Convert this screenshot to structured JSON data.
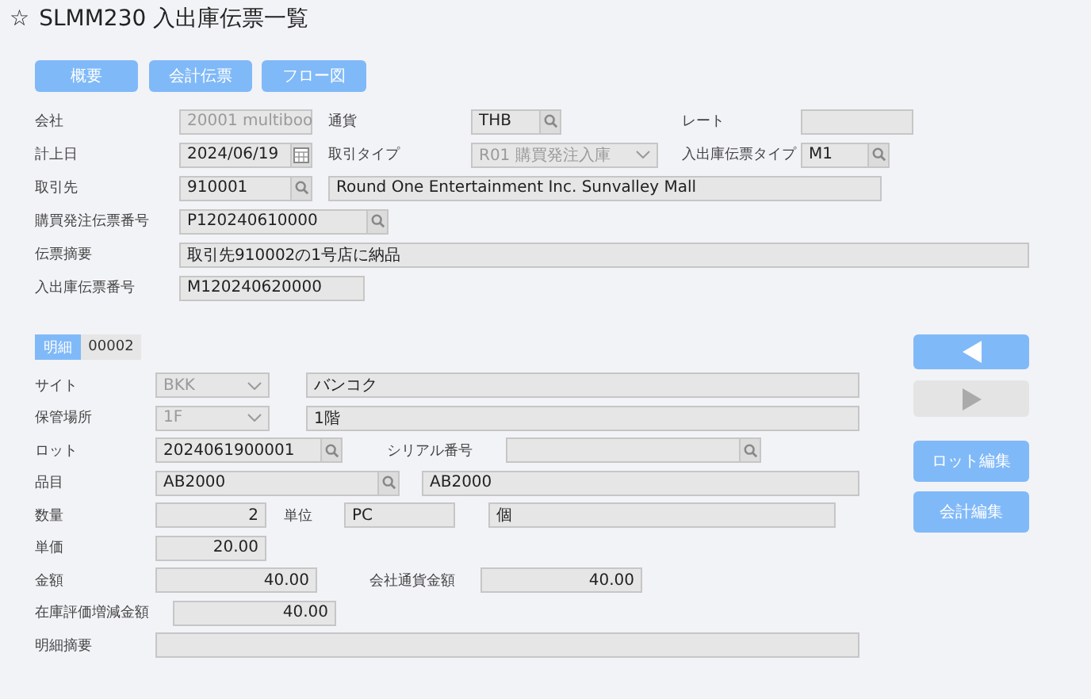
{
  "title": {
    "star": "☆",
    "text": "SLMM230 入出庫伝票一覧"
  },
  "top_buttons": [
    "概要",
    "会計伝票",
    "フロー図"
  ],
  "header_rows": [
    [
      {
        "kind": "label",
        "text": "会社"
      },
      {
        "kind": "select",
        "value": "20001 multiboo",
        "disabled": true
      },
      {
        "kind": "label",
        "text": "通貨"
      },
      {
        "kind": "lookup",
        "value": "THB"
      },
      {
        "kind": "label",
        "text": "レート"
      },
      {
        "kind": "text"
      }
    ],
    [
      {
        "kind": "label",
        "text": "計上日"
      },
      {
        "kind": "date",
        "value": "2024/06/19"
      },
      {
        "kind": "label",
        "text": "取引タイプ"
      },
      {
        "kind": "select",
        "value": "R01 購買発注入庫",
        "disabled": true
      },
      {
        "kind": "label",
        "text": "入出庫伝票タイプ"
      },
      {
        "kind": "lookup",
        "value": "M1"
      }
    ],
    [
      {
        "kind": "label",
        "text": "取引先"
      },
      {
        "kind": "lookup",
        "value": "910001"
      },
      {
        "kind": "text",
        "value": "Round One Entertainment Inc. Sunvalley Mall"
      }
    ],
    [
      {
        "kind": "label",
        "text": "購買発注伝票番号"
      },
      {
        "kind": "lookup",
        "value": "P120240610000"
      }
    ],
    [
      {
        "kind": "label",
        "text": "伝票摘要"
      },
      {
        "kind": "text",
        "value": "取引先910002の1号店に納品"
      }
    ],
    [
      {
        "kind": "label",
        "text": "入出庫伝票番号"
      },
      {
        "kind": "text",
        "value": "M120240620000"
      }
    ]
  ],
  "detail_tab": {
    "label": "明細",
    "number": "00002",
    "selected": true
  },
  "detail_rows": [
    [
      {
        "kind": "label",
        "text": "サイト"
      },
      {
        "kind": "select",
        "value": "BKK",
        "disabled": true
      },
      {
        "kind": "text",
        "value": "バンコク"
      }
    ],
    [
      {
        "kind": "label",
        "text": "保管場所"
      },
      {
        "kind": "select",
        "value": "1F",
        "disabled": true
      },
      {
        "kind": "text",
        "value": "1階"
      }
    ],
    [
      {
        "kind": "label",
        "text": "ロット"
      },
      {
        "kind": "lookup",
        "value": "2024061900001"
      },
      {
        "kind": "label",
        "text": "シリアル番号"
      },
      {
        "kind": "lookup"
      }
    ],
    [
      {
        "kind": "label",
        "text": "品目"
      },
      {
        "kind": "lookup",
        "value": "AB2000"
      },
      {
        "kind": "text",
        "value": "AB2000"
      }
    ],
    [
      {
        "kind": "label",
        "text": "数量"
      },
      {
        "kind": "number",
        "value": "2"
      },
      {
        "kind": "label",
        "text": "単位"
      },
      {
        "kind": "text",
        "value": "PC"
      },
      {
        "kind": "text",
        "value": "個"
      }
    ],
    [
      {
        "kind": "label",
        "text": "単価"
      },
      {
        "kind": "number",
        "value": "20.00"
      }
    ],
    [
      {
        "kind": "label",
        "text": "金額"
      },
      {
        "kind": "number",
        "value": "40.00"
      },
      {
        "kind": "label",
        "text": "会社通貨金額"
      },
      {
        "kind": "number",
        "value": "40.00"
      }
    ],
    [
      {
        "kind": "label",
        "text": "在庫評価増減金額"
      },
      {
        "kind": "number",
        "value": "40.00"
      }
    ],
    [
      {
        "kind": "label",
        "text": "明細摘要"
      },
      {
        "kind": "text"
      }
    ]
  ],
  "side_buttons": [
    {
      "kind": "prev",
      "disabled": false
    },
    {
      "kind": "next",
      "disabled": true
    },
    {
      "kind": "text",
      "label": "ロット編集"
    },
    {
      "kind": "text",
      "label": "会計編集"
    }
  ]
}
